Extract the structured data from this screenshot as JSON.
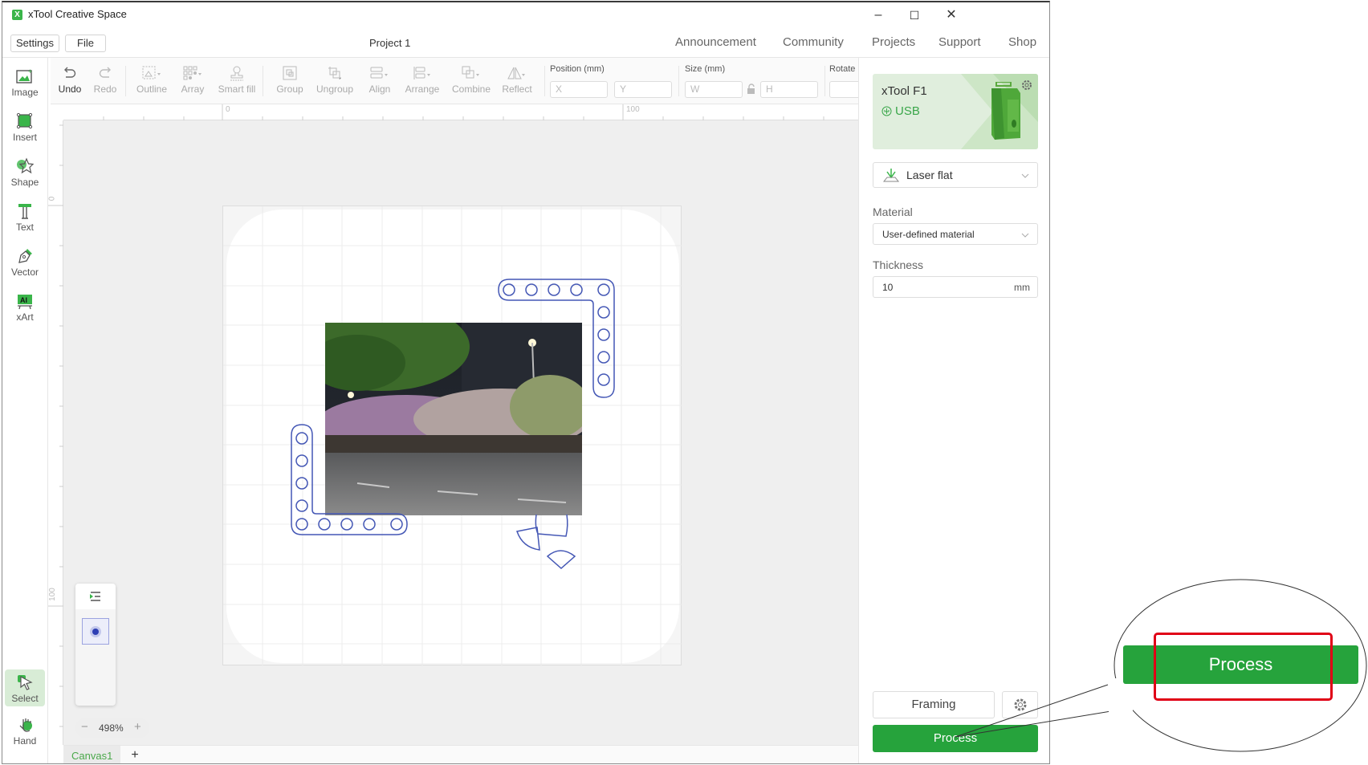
{
  "window": {
    "title": "xTool Creative Space",
    "logo_glyph": "X",
    "controls": {
      "minimize": "–",
      "maximize": "☐",
      "close": "✕"
    }
  },
  "menu": {
    "settings_label": "Settings",
    "file_label": "File",
    "project_title": "Project 1",
    "nav": [
      "Announcement",
      "Community",
      "Projects",
      "Support",
      "Shop"
    ]
  },
  "toolbar": {
    "tools": [
      {
        "label": "Undo",
        "icon": "undo-icon",
        "enabled": true
      },
      {
        "label": "Redo",
        "icon": "redo-icon",
        "enabled": false
      },
      {
        "label": "Outline",
        "icon": "outline-icon",
        "enabled": false
      },
      {
        "label": "Array",
        "icon": "array-icon",
        "enabled": false
      },
      {
        "label": "Smart fill",
        "icon": "smart-fill-icon",
        "enabled": false
      },
      {
        "label": "Group",
        "icon": "group-icon",
        "enabled": false
      },
      {
        "label": "Ungroup",
        "icon": "ungroup-icon",
        "enabled": false
      },
      {
        "label": "Align",
        "icon": "align-icon",
        "enabled": false
      },
      {
        "label": "Arrange",
        "icon": "arrange-icon",
        "enabled": false
      },
      {
        "label": "Combine",
        "icon": "combine-icon",
        "enabled": false
      },
      {
        "label": "Reflect",
        "icon": "reflect-icon",
        "enabled": false
      }
    ],
    "position_label": "Position (mm)",
    "x_placeholder": "X",
    "y_placeholder": "Y",
    "size_label": "Size (mm)",
    "w_placeholder": "W",
    "h_placeholder": "H",
    "rotate_label": "Rotate"
  },
  "sidebar": {
    "items": [
      {
        "label": "Image",
        "icon": "image-icon"
      },
      {
        "label": "Insert",
        "icon": "insert-icon"
      },
      {
        "label": "Shape",
        "icon": "shape-icon"
      },
      {
        "label": "Text",
        "icon": "text-icon"
      },
      {
        "label": "Vector",
        "icon": "vector-pen-icon"
      },
      {
        "label": "xArt",
        "icon": "xart-icon"
      }
    ],
    "bottom": [
      {
        "label": "Select",
        "icon": "select-cursor-icon",
        "selected": true
      },
      {
        "label": "Hand",
        "icon": "hand-icon",
        "selected": false
      }
    ]
  },
  "rulers": {
    "top_labels": [
      "0",
      "100"
    ],
    "left_labels": [
      "0",
      "100"
    ]
  },
  "canvas": {
    "zoom_level": "498%",
    "zoom_out": "−",
    "zoom_in": "+",
    "tabs": [
      "Canvas1"
    ],
    "add_tab": "+"
  },
  "device": {
    "name": "xTool F1",
    "connection": "USB",
    "mode": "Laser flat",
    "material_label": "Material",
    "material_value": "User-defined material",
    "thickness_label": "Thickness",
    "thickness_value": "10",
    "thickness_unit": "mm"
  },
  "actions": {
    "framing_label": "Framing",
    "process_label": "Process"
  },
  "callout": {
    "process_label": "Process"
  },
  "colors": {
    "accent_green": "#26a33c",
    "vector_blue": "#4457b5",
    "highlight_red": "#e00016"
  }
}
